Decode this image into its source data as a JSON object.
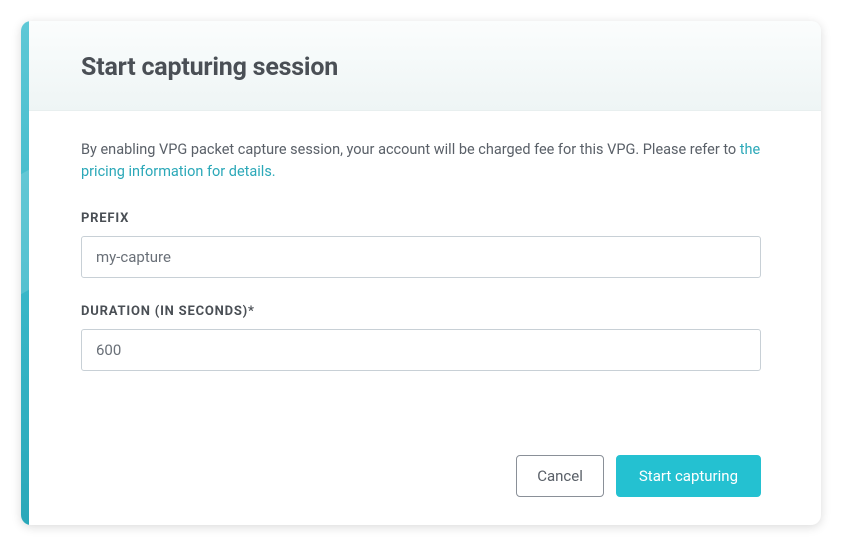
{
  "header": {
    "title": "Start capturing session"
  },
  "description": {
    "text": "By enabling VPG packet capture session, your account will be charged fee for this VPG. Please refer to ",
    "link_text": "the pricing information for details."
  },
  "form": {
    "prefix": {
      "label": "PREFIX",
      "value": "my-capture"
    },
    "duration": {
      "label": "DURATION (IN SECONDS)*",
      "value": "600"
    }
  },
  "footer": {
    "cancel_label": "Cancel",
    "submit_label": "Start capturing"
  }
}
